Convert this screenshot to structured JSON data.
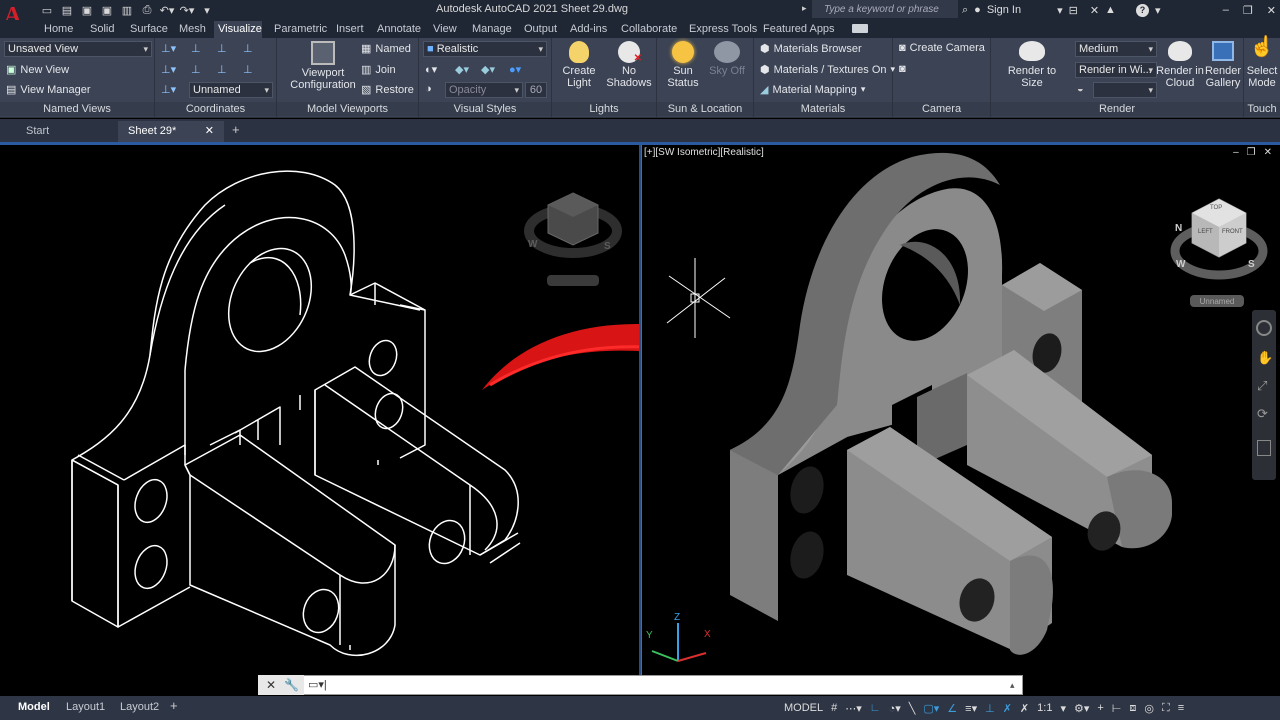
{
  "app": {
    "title": "Autodesk AutoCAD 2021   Sheet 29.dwg",
    "logo_letter": "A",
    "search_placeholder": "Type a keyword or phrase",
    "sign_in": "Sign In"
  },
  "ribbon_tabs": [
    "Home",
    "Solid",
    "Surface",
    "Mesh",
    "Visualize",
    "Parametric",
    "Insert",
    "Annotate",
    "View",
    "Manage",
    "Output",
    "Add-ins",
    "Collaborate",
    "Express Tools",
    "Featured Apps"
  ],
  "active_tab": "Visualize",
  "ribbon": {
    "named_views": {
      "view_dropdown": "Unsaved View",
      "new_view": "New View",
      "view_manager": "View Manager",
      "label": "Named Views"
    },
    "coordinates": {
      "ucs_dropdown": "Unnamed",
      "label": "Coordinates"
    },
    "model_viewports": {
      "viewport_config": "Viewport\nConfiguration",
      "named": "Named",
      "join": "Join",
      "restore": "Restore",
      "label": "Model Viewports"
    },
    "visual_styles": {
      "style_dropdown": "Realistic",
      "opacity_placeholder": "Opacity",
      "opacity_value": "60",
      "label": "Visual Styles"
    },
    "lights": {
      "create_light": "Create\nLight",
      "no_shadows": "No\nShadows",
      "label": "Lights"
    },
    "sun_location": {
      "sun_status": "Sun\nStatus",
      "sky_off": "Sky Off",
      "label": "Sun & Location"
    },
    "materials": {
      "browser": "Materials Browser",
      "textures": "Materials / Textures On",
      "mapping": "Material Mapping",
      "label": "Materials"
    },
    "camera": {
      "create_camera": "Create Camera",
      "label": "Camera"
    },
    "render": {
      "render_to_size": "Render to Size",
      "quality_dropdown": "Medium",
      "render_in": "Render in Wi...",
      "render_cloud": "Render in\nCloud",
      "render_gallery": "Render\nGallery",
      "label": "Render"
    },
    "touch": {
      "select_mode": "Select\nMode",
      "label": "Touch"
    }
  },
  "file_tabs": [
    "Start",
    "Sheet 29*"
  ],
  "viewport_label": "[+][SW Isometric][Realistic]",
  "viewcube": {
    "top": "TOP",
    "left": "LEFT",
    "front": "FRONT",
    "n": "N",
    "w": "W",
    "s": "S",
    "ucs_name": "Unnamed"
  },
  "axes": {
    "x": "X",
    "y": "Y",
    "z": "Z"
  },
  "layout_tabs": [
    "Model",
    "Layout1",
    "Layout2"
  ],
  "status": {
    "model": "MODEL",
    "scale": "1:1"
  },
  "colors": {
    "accent": "#2c5aa0",
    "arrow": "#d81414",
    "solid_gray": "#8a8a8a"
  }
}
